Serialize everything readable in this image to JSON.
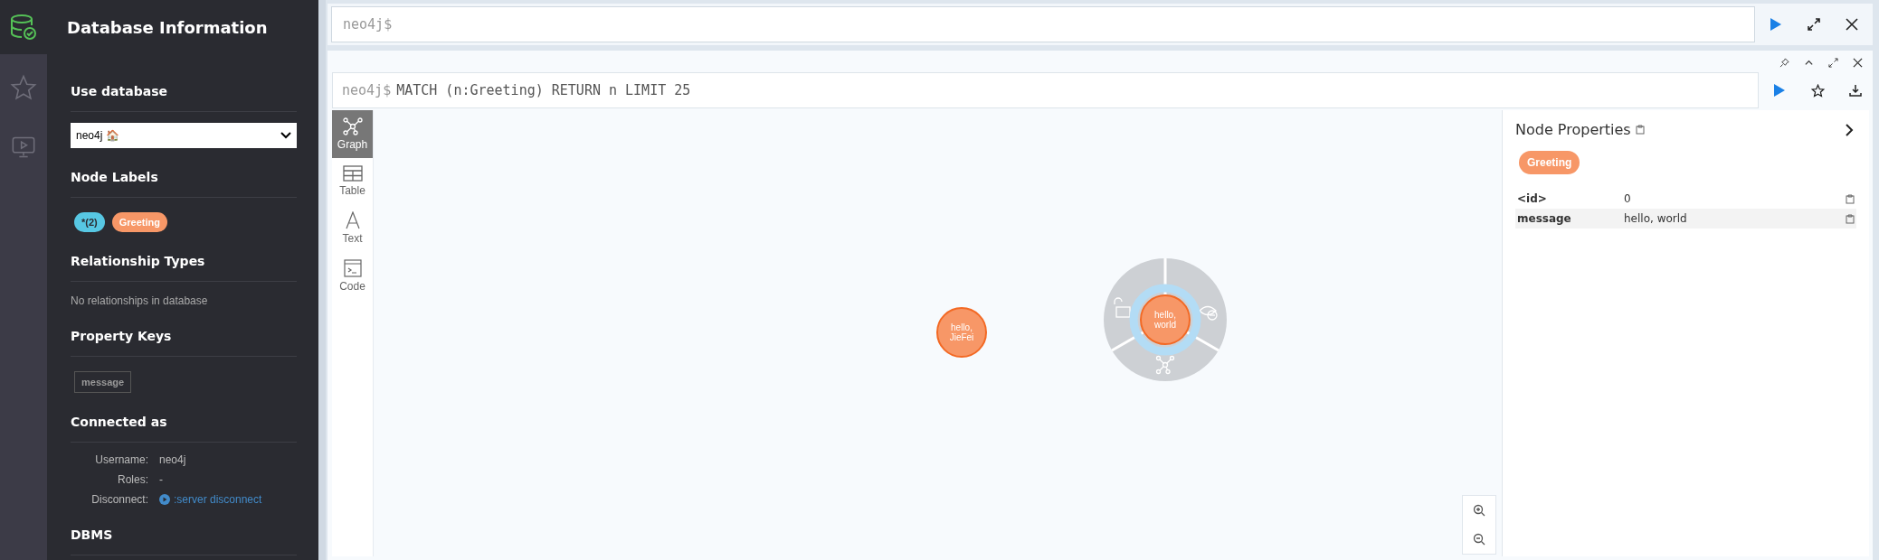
{
  "sidebar_nav": [
    {
      "kind": "database",
      "selected": true
    },
    {
      "kind": "star",
      "selected": false
    },
    {
      "kind": "monitor",
      "selected": false
    }
  ],
  "drawer": {
    "title": "Database Information",
    "use_database": {
      "heading": "Use database",
      "value": "neo4j 🏠"
    },
    "node_labels": {
      "heading": "Node Labels",
      "labels": [
        {
          "text": "*(2)",
          "color": "#57c7e3"
        },
        {
          "text": "Greeting",
          "color": "#f79767"
        }
      ]
    },
    "relationship_types": {
      "heading": "Relationship Types",
      "empty_text": "No relationships in database"
    },
    "property_keys": {
      "heading": "Property Keys",
      "keys": [
        "message"
      ]
    },
    "connected_as": {
      "heading": "Connected as",
      "rows": [
        {
          "label": "Username:",
          "value": "neo4j",
          "kind": "text"
        },
        {
          "label": "Roles:",
          "value": "-",
          "kind": "text"
        },
        {
          "label": "Disconnect:",
          "value": ":server disconnect",
          "kind": "link"
        }
      ]
    },
    "dbms": {
      "heading": "DBMS"
    }
  },
  "editor": {
    "prompt": "neo4j$"
  },
  "result_frame": {
    "prompt": "neo4j$",
    "query": "MATCH (n:Greeting) RETURN n LIMIT 25",
    "view_tabs": [
      {
        "label": "Graph",
        "kind": "graph",
        "selected": true
      },
      {
        "label": "Table",
        "kind": "table",
        "selected": false
      },
      {
        "label": "Text",
        "kind": "text",
        "selected": false
      },
      {
        "label": "Code",
        "kind": "code",
        "selected": false
      }
    ],
    "nodes": [
      {
        "caption_lines": [
          "hello,",
          "JieFei"
        ],
        "selected": false
      },
      {
        "caption_lines": [
          "hello,",
          "world"
        ],
        "selected": true
      }
    ],
    "node_properties": {
      "title": "Node Properties",
      "label": {
        "text": "Greeting",
        "color": "#f79767"
      },
      "rows": [
        {
          "key": "<id>",
          "value": "0"
        },
        {
          "key": "message",
          "value": "hello, world"
        }
      ]
    }
  }
}
